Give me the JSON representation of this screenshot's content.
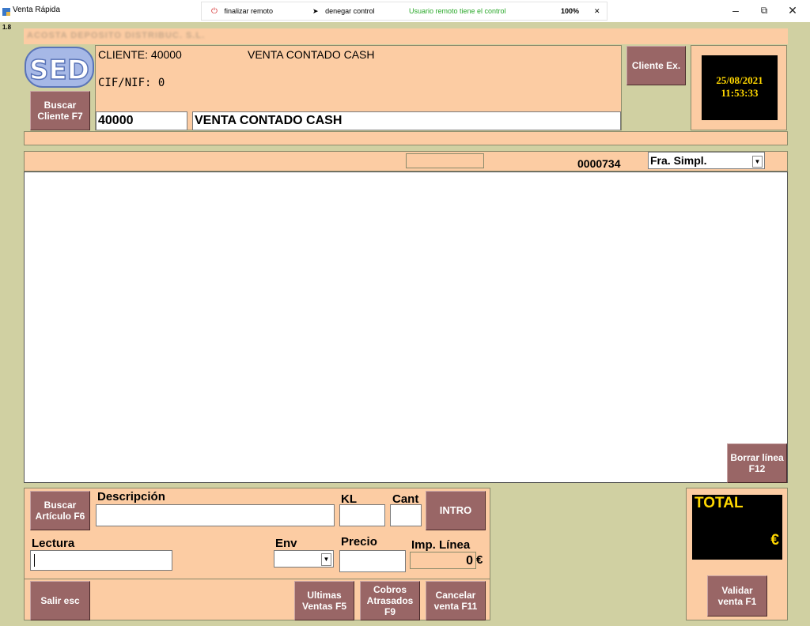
{
  "window": {
    "title": "Venta Rápida",
    "version": "1.8"
  },
  "remote": {
    "finish_label": "finalizar remoto",
    "deny_label": "denegar control",
    "status": "Usuario remoto tiene el control",
    "zoom": "100%"
  },
  "company_name": "ACOSTA DEPOSITO DISTRIBUC. S.L.",
  "logo_text": "SED",
  "client": {
    "code_line": "CLIENTE: 40000",
    "name_line": "VENTA CONTADO CASH",
    "cif_line": "CIF/NIF: 0",
    "code_value": "40000",
    "name_value": "VENTA CONTADO CASH"
  },
  "buttons": {
    "buscar_cliente": "Buscar Cliente F7",
    "cliente_ex": "Cliente Ex.",
    "borrar_linea": "Borrar línea F12",
    "buscar_articulo": "Buscar Artículo F6",
    "intro": "INTRO",
    "salir": "Salir esc",
    "ultimas_ventas": "Ultimas Ventas F5",
    "cobros_atrasados": "Cobros Atrasados F9",
    "cancelar_venta": "Cancelar venta F11",
    "validar_venta": "Validar venta F1"
  },
  "clock": {
    "date": "25/08/2021",
    "time": "11:53:33"
  },
  "invoice": {
    "number": "0000734",
    "type_selected": "Fra. Simpl."
  },
  "entry": {
    "descripcion_label": "Descripción",
    "kl_label": "KL",
    "cant_label": "Cant",
    "lectura_label": "Lectura",
    "env_label": "Env",
    "precio_label": "Precio",
    "imp_linea_label": "Imp. Línea",
    "imp_linea_value": "0",
    "euro": "€"
  },
  "total": {
    "label": "TOTAL",
    "currency": "€"
  },
  "colors": {
    "background": "#d0d0a2",
    "panel": "#fccca3",
    "button": "#996666",
    "clock_text": "#ffd700",
    "remote_status": "#2aa82a"
  }
}
